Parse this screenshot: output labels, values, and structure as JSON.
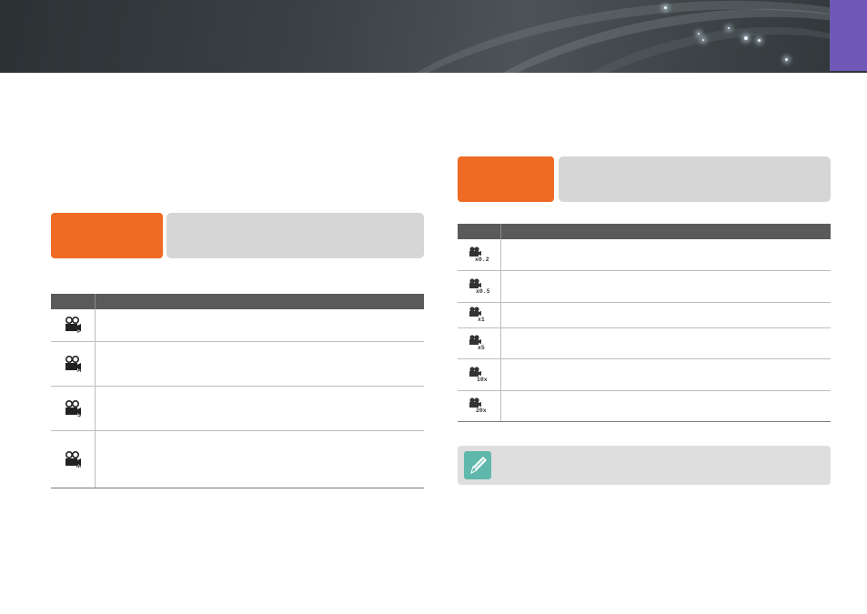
{
  "header": {
    "banner": "decorative-banner",
    "accent_color": "#6f58b8"
  },
  "left_section": {
    "label_color": "#ee6a25",
    "table": {
      "rows": [
        {
          "icon": "movie-program-icon",
          "mode": "P"
        },
        {
          "icon": "movie-aperture-priority-icon",
          "mode": "A"
        },
        {
          "icon": "movie-shutter-priority-icon",
          "mode": "S"
        },
        {
          "icon": "movie-manual-icon",
          "mode": "M"
        }
      ]
    }
  },
  "right_section": {
    "label_color": "#ee6a25",
    "table": {
      "rows": [
        {
          "icon": "movie-speed-x025-icon",
          "speed": "x0.25"
        },
        {
          "icon": "movie-speed-x05-icon",
          "speed": "x0.5"
        },
        {
          "icon": "movie-speed-x1-icon",
          "speed": "x1"
        },
        {
          "icon": "movie-speed-x5-icon",
          "speed": "x5"
        },
        {
          "icon": "movie-speed-x10-icon",
          "speed": "x10"
        },
        {
          "icon": "movie-speed-x20-icon",
          "speed": "x20"
        }
      ]
    }
  },
  "note": {
    "icon": "pencil-note-icon",
    "icon_color": "#5fb8ab"
  }
}
